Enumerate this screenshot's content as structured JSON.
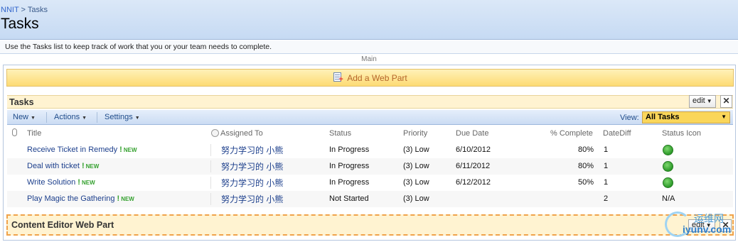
{
  "breadcrumb": {
    "site": "NNIT",
    "separator": ">",
    "current": "Tasks"
  },
  "page": {
    "title": "Tasks",
    "description": "Use the Tasks list to keep track of work that you or your team needs to complete."
  },
  "zone": {
    "label": "Main",
    "add_web_part": "Add a Web Part"
  },
  "webpart": {
    "title": "Tasks",
    "edit_label": "edit",
    "close_label": "✕"
  },
  "toolbar": {
    "new_label": "New",
    "actions_label": "Actions",
    "settings_label": "Settings",
    "view_label": "View:",
    "view_value": "All Tasks"
  },
  "columns": {
    "title": "Title",
    "assigned_to": "Assigned To",
    "status": "Status",
    "priority": "Priority",
    "due_date": "Due Date",
    "pct_complete": "% Complete",
    "date_diff": "DateDiff",
    "status_icon": "Status Icon"
  },
  "new_badge": "NEW",
  "new_mark": "!",
  "rows": [
    {
      "title": "Receive Ticket in Remedy",
      "assigned_to": "努力学习的 小熊",
      "status": "In Progress",
      "priority": "(3) Low",
      "due_date": "6/10/2012",
      "pct_complete": "80%",
      "date_diff": "1",
      "status_icon": "green-circle",
      "status_text": ""
    },
    {
      "title": "Deal with ticket",
      "assigned_to": "努力学习的 小熊",
      "status": "In Progress",
      "priority": "(3) Low",
      "due_date": "6/11/2012",
      "pct_complete": "80%",
      "date_diff": "1",
      "status_icon": "green-circle",
      "status_text": ""
    },
    {
      "title": "Write Solution",
      "assigned_to": "努力学习的 小熊",
      "status": "In Progress",
      "priority": "(3) Low",
      "due_date": "6/12/2012",
      "pct_complete": "50%",
      "date_diff": "1",
      "status_icon": "green-circle",
      "status_text": ""
    },
    {
      "title": "Play Magic the Gathering",
      "assigned_to": "努力学习的 小熊",
      "status": "Not Started",
      "priority": "(3) Low",
      "due_date": "",
      "pct_complete": "",
      "date_diff": "2",
      "status_icon": "none",
      "status_text": "N/A"
    }
  ],
  "content_editor": {
    "title": "Content Editor Web Part",
    "edit_label": "edit",
    "close_label": "✕"
  },
  "watermark": {
    "cn": "运维网",
    "en": "iyunv.com"
  },
  "colors": {
    "accent": "#fddb74",
    "link": "#1c3f8c",
    "status_green": "#2d9a2a",
    "new_green": "#35a12f"
  }
}
